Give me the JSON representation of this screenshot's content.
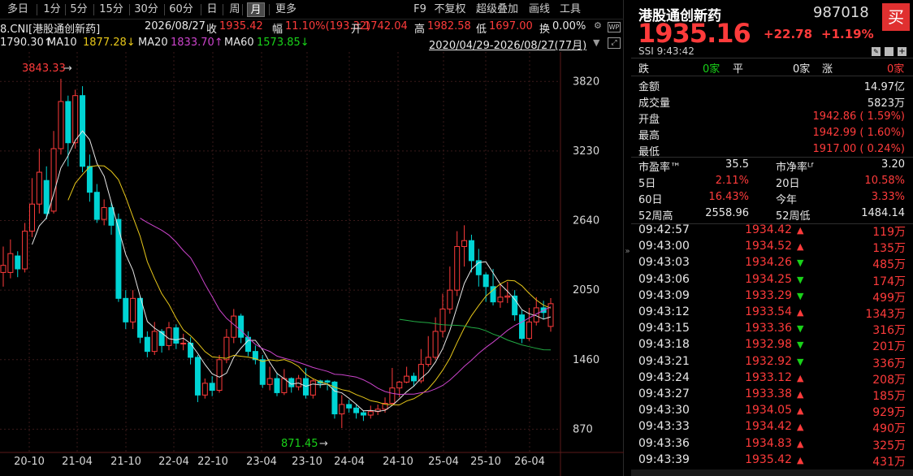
{
  "toolbar": {
    "periods": [
      "多日",
      "1分",
      "5分",
      "15分",
      "30分",
      "60分",
      "日",
      "周",
      "月",
      "更多"
    ],
    "active_period": "月",
    "right_items": [
      "F9",
      "不复权",
      "超级叠加",
      "画线",
      "工具"
    ]
  },
  "info": {
    "code_prefix": "8.CNI[港股通创新药]",
    "date": "2026/08/27",
    "close_label": "收",
    "close": "1935.42",
    "change_label": "幅",
    "change": "11.10%(193.32)",
    "open_label": "开",
    "open": "1742.04",
    "high_label": "高",
    "high": "1982.58",
    "low_label": "低",
    "low": "1697.00",
    "turnover_label": "换",
    "turnover": "0.00%"
  },
  "ma": {
    "ma5_val": "1790.30↑",
    "ma10_label": "MA10",
    "ma10_val": "1877.28↓",
    "ma20_label": "MA20",
    "ma20_val": "1833.70↑",
    "ma60_label": "MA60",
    "ma60_val": "1573.85↓",
    "range": "2020/04/29-2026/08/27(77月)"
  },
  "colors": {
    "up": "#ff3b3b",
    "down": "#00d4d4",
    "ma5": "#e6e6e6",
    "ma10": "#e6c619",
    "ma20": "#cc44cc",
    "ma60": "#22aa44"
  },
  "chart_data": {
    "type": "candlestick",
    "yticks": [
      "3820",
      "3230",
      "2640",
      "2050",
      "1460",
      "870"
    ],
    "xticks": [
      "20-10",
      "21-04",
      "21-10",
      "22-04",
      "22-10",
      "23-04",
      "23-10",
      "24-04",
      "24-10",
      "25-04",
      "25-10",
      "26-04"
    ],
    "high_label": "3843.33",
    "low_label": "871.45",
    "candles": [
      [
        2200,
        2260,
        2420,
        2080
      ],
      [
        2200,
        2360,
        2480,
        2150
      ],
      [
        2340,
        2230,
        2380,
        2160
      ],
      [
        2230,
        2550,
        2620,
        2200
      ],
      [
        2550,
        2780,
        3000,
        2500
      ],
      [
        2780,
        3050,
        3250,
        2700
      ],
      [
        2980,
        2700,
        3100,
        2650
      ],
      [
        2720,
        3250,
        3400,
        2700
      ],
      [
        3250,
        3650,
        3843,
        3200
      ],
      [
        3650,
        3300,
        3700,
        3100
      ],
      [
        3300,
        3700,
        3750,
        3250
      ],
      [
        3700,
        3100,
        3780,
        3050
      ],
      [
        3100,
        2880,
        3200,
        2800
      ],
      [
        2880,
        2650,
        2950,
        2620
      ],
      [
        2650,
        2750,
        2820,
        2600
      ],
      [
        2750,
        2600,
        2800,
        2520
      ],
      [
        2650,
        1980,
        2700,
        1950
      ],
      [
        1980,
        1780,
        2050,
        1720
      ],
      [
        1780,
        1980,
        2050,
        1720
      ],
      [
        1980,
        1650,
        2000,
        1600
      ],
      [
        1650,
        1530,
        1700,
        1480
      ],
      [
        1530,
        1700,
        1780,
        1500
      ],
      [
        1700,
        1580,
        1720,
        1520
      ],
      [
        1580,
        1730,
        1780,
        1540
      ],
      [
        1730,
        1600,
        1760,
        1550
      ],
      [
        1600,
        1600,
        1680,
        1540
      ],
      [
        1600,
        1480,
        1650,
        1420
      ],
      [
        1480,
        1160,
        1500,
        1100
      ],
      [
        1160,
        1260,
        1300,
        1130
      ],
      [
        1260,
        1200,
        1320,
        1150
      ],
      [
        1200,
        1460,
        1500,
        1180
      ],
      [
        1460,
        1650,
        1720,
        1430
      ],
      [
        1650,
        1830,
        1890,
        1600
      ],
      [
        1830,
        1650,
        1850,
        1600
      ],
      [
        1650,
        1530,
        1700,
        1490
      ],
      [
        1530,
        1460,
        1580,
        1420
      ],
      [
        1460,
        1250,
        1500,
        1220
      ],
      [
        1250,
        1300,
        1400,
        1200
      ],
      [
        1300,
        1180,
        1350,
        1150
      ],
      [
        1180,
        1300,
        1380,
        1160
      ],
      [
        1300,
        1230,
        1310,
        1180
      ],
      [
        1230,
        1300,
        1330,
        1200
      ],
      [
        1300,
        1160,
        1390,
        1130
      ],
      [
        1160,
        1280,
        1300,
        1130
      ],
      [
        1280,
        1260,
        1290,
        1220
      ],
      [
        1280,
        1270,
        1290,
        1200
      ],
      [
        1270,
        1000,
        1280,
        960
      ],
      [
        1000,
        1080,
        1160,
        880
      ],
      [
        1080,
        1050,
        1120,
        1010
      ],
      [
        1050,
        1010,
        1080,
        960
      ],
      [
        1010,
        990,
        1030,
        940
      ],
      [
        990,
        1020,
        1070,
        960
      ],
      [
        1020,
        1040,
        1080,
        990
      ],
      [
        1040,
        1090,
        1140,
        1010
      ],
      [
        1090,
        1220,
        1390,
        1070
      ],
      [
        1220,
        1270,
        1280,
        1140
      ],
      [
        1270,
        1320,
        1400,
        1260
      ],
      [
        1320,
        1280,
        1350,
        1230
      ],
      [
        1280,
        1420,
        1550,
        1260
      ],
      [
        1420,
        1480,
        1660,
        1400
      ],
      [
        1480,
        1700,
        1820,
        1460
      ],
      [
        1700,
        1890,
        2020,
        1650
      ],
      [
        1890,
        2050,
        2250,
        1850
      ],
      [
        2050,
        2420,
        2550,
        2000
      ],
      [
        2420,
        2470,
        2600,
        2250
      ],
      [
        2470,
        2300,
        2520,
        2200
      ],
      [
        2300,
        2180,
        2400,
        2080
      ],
      [
        2180,
        2080,
        2200,
        1950
      ],
      [
        2080,
        1950,
        2230,
        1920
      ],
      [
        1950,
        1990,
        2100,
        1900
      ],
      [
        1990,
        2000,
        2120,
        1940
      ],
      [
        2000,
        1840,
        2050,
        1790
      ],
      [
        1840,
        1640,
        1880,
        1600
      ],
      [
        1640,
        1780,
        1900,
        1620
      ],
      [
        1780,
        1900,
        1990,
        1750
      ],
      [
        1900,
        1860,
        1960,
        1800
      ],
      [
        1742,
        1935,
        1982,
        1697
      ]
    ]
  },
  "side": {
    "title": "港股通创新药",
    "code": "987018",
    "buy": "买",
    "price": "1935.16",
    "chg": "+22.78",
    "pct": "+1.19%",
    "sub": "SSI  9:43:42",
    "stats": {
      "fall_label": "跌",
      "fall_val": "0家",
      "flat_label": "平",
      "flat_val": "0家",
      "rise_label": "涨",
      "rise_val": "0家"
    },
    "rows": [
      {
        "label": "金额",
        "value": "14.97亿",
        "cls": "white"
      },
      {
        "label": "成交量",
        "value": "5823万",
        "cls": "white"
      },
      {
        "label": "开盘",
        "value": "1942.86 ( 1.59%)",
        "cls": "red"
      },
      {
        "label": "最高",
        "value": "1942.99 ( 1.60%)",
        "cls": "red"
      },
      {
        "label": "最低",
        "value": "1917.00 ( 0.24%)",
        "cls": "red"
      }
    ],
    "pair_rows": [
      {
        "l1": "市盈率™",
        "v1": "35.5",
        "c1": "white",
        "l2": "市净率ᴸᶠ",
        "v2": "3.20",
        "c2": "white"
      },
      {
        "l1": "5日",
        "v1": "2.11%",
        "c1": "red",
        "l2": "20日",
        "v2": "10.58%",
        "c2": "red"
      },
      {
        "l1": "60日",
        "v1": "16.43%",
        "c1": "red",
        "l2": "今年",
        "v2": "3.33%",
        "c2": "red"
      },
      {
        "l1": "52周高",
        "v1": "2558.96",
        "c1": "white",
        "l2": "52周低",
        "v2": "1484.14",
        "c2": "white"
      }
    ],
    "ticks": [
      {
        "t": "09:42:57",
        "p": "1934.42",
        "d": "up",
        "v": "119万"
      },
      {
        "t": "09:43:00",
        "p": "1934.52",
        "d": "up",
        "v": "135万"
      },
      {
        "t": "09:43:03",
        "p": "1934.26",
        "d": "down",
        "v": "485万"
      },
      {
        "t": "09:43:06",
        "p": "1934.25",
        "d": "down",
        "v": "174万"
      },
      {
        "t": "09:43:09",
        "p": "1933.29",
        "d": "down",
        "v": "499万"
      },
      {
        "t": "09:43:12",
        "p": "1933.54",
        "d": "up",
        "v": "1343万"
      },
      {
        "t": "09:43:15",
        "p": "1933.36",
        "d": "down",
        "v": "316万"
      },
      {
        "t": "09:43:18",
        "p": "1932.98",
        "d": "down",
        "v": "201万"
      },
      {
        "t": "09:43:21",
        "p": "1932.92",
        "d": "down",
        "v": "336万"
      },
      {
        "t": "09:43:24",
        "p": "1933.12",
        "d": "up",
        "v": "208万"
      },
      {
        "t": "09:43:27",
        "p": "1933.38",
        "d": "up",
        "v": "185万"
      },
      {
        "t": "09:43:30",
        "p": "1934.05",
        "d": "up",
        "v": "929万"
      },
      {
        "t": "09:43:33",
        "p": "1934.42",
        "d": "up",
        "v": "490万"
      },
      {
        "t": "09:43:36",
        "p": "1934.83",
        "d": "up",
        "v": "325万"
      },
      {
        "t": "09:43:39",
        "p": "1935.42",
        "d": "up",
        "v": "431万"
      }
    ]
  }
}
